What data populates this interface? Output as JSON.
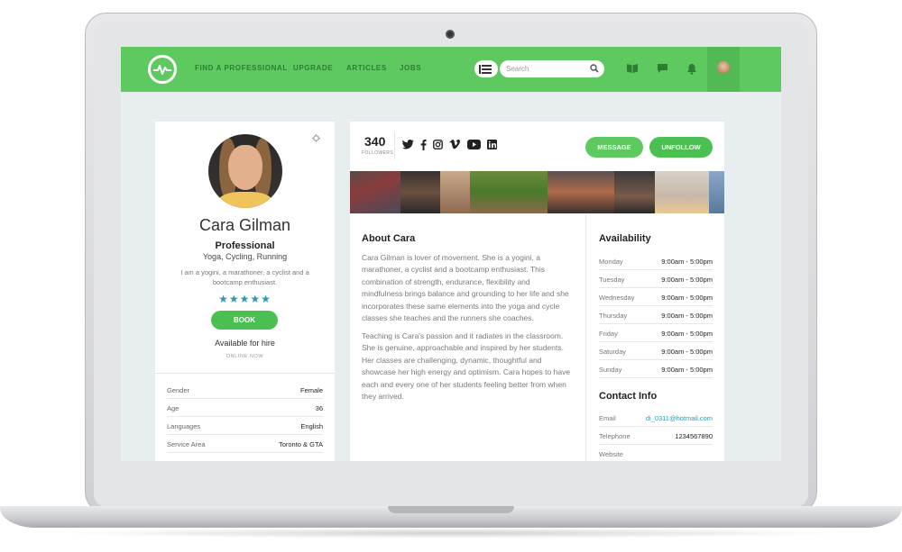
{
  "colors": {
    "accent_green": "#5dc95f",
    "button_green": "#4cbf52",
    "star_teal": "#2b9ab0",
    "link_blue": "#2b9ab0"
  },
  "nav": {
    "logo_icon": "pulse-logo-icon",
    "items": [
      "FIND A PROFESSIONAL",
      "UPGRADE",
      "ARTICLES",
      "JOBS"
    ],
    "search_placeholder": "Search",
    "icons": [
      "list-icon",
      "search-icon",
      "book-icon",
      "chat-icon",
      "bell-icon"
    ]
  },
  "profile": {
    "name": "Cara Gilman",
    "role": "Professional",
    "tags": "Yoga, Cycling, Running",
    "bio": "I am a yogini, a marathoner, a cyclist and a bootcamp enthusiast.",
    "rating_stars": "★★★★★",
    "rating": 5,
    "book_label": "BOOK",
    "hire_status": "Available for hire",
    "online_status": "ONLINE NOW",
    "details": [
      {
        "label": "Gender",
        "value": "Female"
      },
      {
        "label": "Age",
        "value": "36"
      },
      {
        "label": "Languages",
        "value": "English"
      },
      {
        "label": "Service Area",
        "value": "Toronto & GTA"
      }
    ]
  },
  "social": {
    "followers_count": "340",
    "followers_label": "FOLLOWERS",
    "icons": [
      "twitter-icon",
      "facebook-icon",
      "instagram-icon",
      "vimeo-icon",
      "youtube-icon",
      "linkedin-icon"
    ],
    "message_label": "MESSAGE",
    "unfollow_label": "UNFOLLOW"
  },
  "about": {
    "title": "About Cara",
    "paragraph_1": "Cara Gilman is lover of movement. She is a yogini, a marathoner, a cyclist and a bootcamp enthusiast. This combination of strength, endurance, flexibility and mindfulness brings balance and grounding to her life and she incorporates these same elements into the yoga and cycle classes she teaches and the runners she coaches.",
    "paragraph_2": "Teaching is Cara's passion and it radiates in the classroom. She is genuine, approachable and inspired by her students. Her classes are challenging, dynamic, thoughtful and showcase her high energy and optimism. Cara hopes to have each and every one of her students feeling better from when they arrived."
  },
  "availability": {
    "title": "Availability",
    "days": [
      {
        "day": "Monday",
        "hours": "9:00am - 5:00pm"
      },
      {
        "day": "Tuesday",
        "hours": "9:00am - 5:00pm"
      },
      {
        "day": "Wednesday",
        "hours": "9:00am - 5:00pm"
      },
      {
        "day": "Thursday",
        "hours": "9:00am - 5:00pm"
      },
      {
        "day": "Friday",
        "hours": "9:00am - 5:00pm"
      },
      {
        "day": "Saturday",
        "hours": "9:00am - 5:00pm"
      },
      {
        "day": "Sunday",
        "hours": "9:00am - 5:00pm"
      }
    ]
  },
  "contact": {
    "title": "Contact Info",
    "rows": [
      {
        "label": "Email",
        "value": "di_0311@hotmail.com"
      },
      {
        "label": "Telephone",
        "value": "1234567890"
      },
      {
        "label": "Website",
        "value": ""
      }
    ]
  }
}
